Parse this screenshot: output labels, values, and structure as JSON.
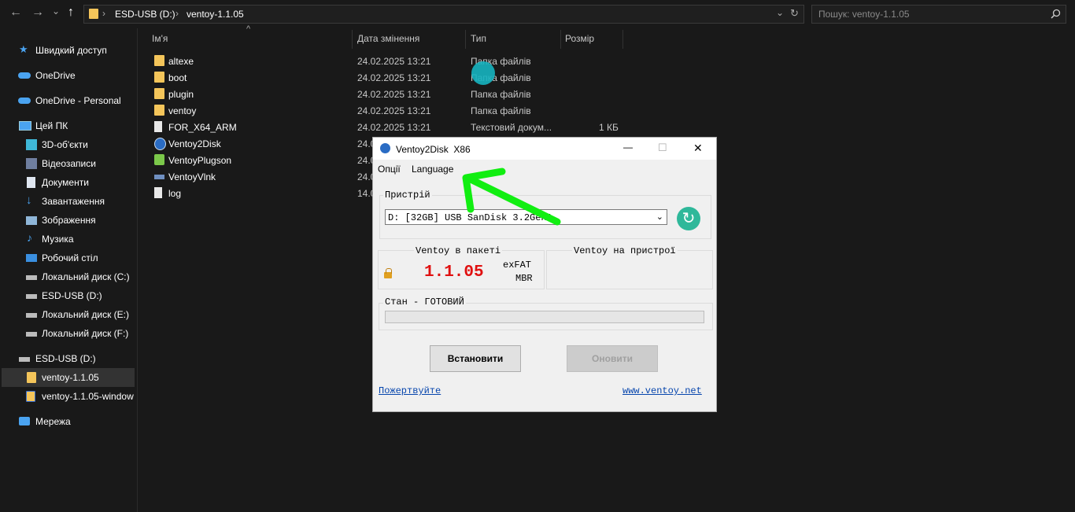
{
  "address_bar": {
    "back": "←",
    "forward": "→",
    "recent": "⌄",
    "up": "↑",
    "crumbs": [
      "ESD-USB (D:)",
      "ventoy-1.1.05"
    ],
    "separator": "›",
    "dropdown": "⌄",
    "refresh": "↻"
  },
  "search": {
    "placeholder": "Пошук: ventoy-1.1.05"
  },
  "sidebar": {
    "items": [
      {
        "label": "Швидкий доступ",
        "icon": "star-icon"
      },
      {
        "label": "OneDrive",
        "icon": "cloud-icon"
      },
      {
        "label": "OneDrive - Personal",
        "icon": "cloud-icon"
      },
      {
        "label": "Цей ПК",
        "icon": "computer-icon"
      },
      {
        "label": "3D-об'єкти",
        "icon": "cube-icon"
      },
      {
        "label": "Відеозаписи",
        "icon": "video-icon"
      },
      {
        "label": "Документи",
        "icon": "document-icon"
      },
      {
        "label": "Завантаження",
        "icon": "download-icon"
      },
      {
        "label": "Зображення",
        "icon": "image-icon"
      },
      {
        "label": "Музика",
        "icon": "music-icon"
      },
      {
        "label": "Робочий стіл",
        "icon": "desktop-icon"
      },
      {
        "label": "Локальний диск (C:)",
        "icon": "drive-icon"
      },
      {
        "label": "ESD-USB (D:)",
        "icon": "drive-icon"
      },
      {
        "label": "Локальний диск (E:)",
        "icon": "drive-icon"
      },
      {
        "label": "Локальний диск (F:)",
        "icon": "drive-icon"
      },
      {
        "label": "ESD-USB (D:)",
        "icon": "drive-icon"
      },
      {
        "label": "ventoy-1.1.05",
        "icon": "folder-icon"
      },
      {
        "label": "ventoy-1.1.05-window",
        "icon": "zip-folder-icon"
      },
      {
        "label": "Мережа",
        "icon": "network-icon"
      }
    ]
  },
  "columns": {
    "name": "Ім'я",
    "date": "Дата змінення",
    "type": "Тип",
    "size": "Розмір",
    "sort_arrow": "^"
  },
  "files": [
    {
      "name": "altexe",
      "date": "24.02.2025 13:21",
      "type": "Папка файлів",
      "size": "",
      "icon": "folder-icon"
    },
    {
      "name": "boot",
      "date": "24.02.2025 13:21",
      "type": "Папка файлів",
      "size": "",
      "icon": "folder-icon"
    },
    {
      "name": "plugin",
      "date": "24.02.2025 13:21",
      "type": "Папка файлів",
      "size": "",
      "icon": "folder-icon"
    },
    {
      "name": "ventoy",
      "date": "24.02.2025 13:21",
      "type": "Папка файлів",
      "size": "",
      "icon": "folder-icon"
    },
    {
      "name": "FOR_X64_ARM",
      "date": "24.02.2025 13:21",
      "type": "Текстовий докум...",
      "size": "1 КБ",
      "icon": "text-file-icon"
    },
    {
      "name": "Ventoy2Disk",
      "date": "24.0",
      "type": "",
      "size": "",
      "icon": "app-icon"
    },
    {
      "name": "VentoyPlugson",
      "date": "24.0",
      "type": "",
      "size": "",
      "icon": "puzzle-icon"
    },
    {
      "name": "VentoyVlnk",
      "date": "24.0",
      "type": "",
      "size": "",
      "icon": "link-app-icon"
    },
    {
      "name": "log",
      "date": "14.0",
      "type": "",
      "size": "",
      "icon": "text-file-icon"
    }
  ],
  "dialog": {
    "title": "Ventoy2Disk  X86",
    "minimize": "—",
    "maximize": "☐",
    "close": "✕",
    "menu": [
      "Опції",
      "Language"
    ],
    "device_group": "Пристрій",
    "device_value": "D: [32GB] USB SanDisk 3.2Gen1",
    "refresh_icon": "↻",
    "package_group": "Ventoy в пакеті",
    "package_version": "1.1.05",
    "package_fs": "exFAT",
    "package_style": "MBR",
    "device_group2": "Ventoy на пристрої",
    "status_group": "Стан - ГОТОВИЙ",
    "progress": 0,
    "install_button": "Встановити",
    "update_button": "Оновити",
    "donate_link": "Пожертвуйте",
    "site_link": "www.ventoy.net",
    "lock_icon": "lock-icon"
  },
  "colors": {
    "accent_arrow": "#11ee11",
    "cursor": "#16b4c0",
    "version": "#e01010"
  }
}
